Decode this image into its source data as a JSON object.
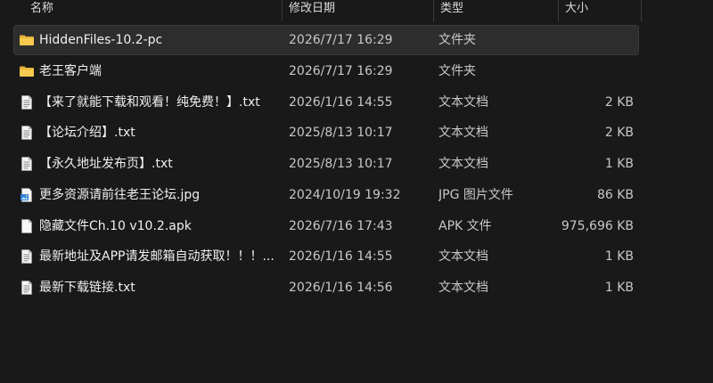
{
  "columns": {
    "name": "名称",
    "date": "修改日期",
    "type": "类型",
    "size": "大小"
  },
  "files": [
    {
      "icon": "folder-icon",
      "name": "HiddenFiles-10.2-pc",
      "date": "2026/7/17 16:29",
      "type": "文件夹",
      "size": "",
      "selected": true
    },
    {
      "icon": "folder-icon",
      "name": "老王客户端",
      "date": "2026/7/17 16:29",
      "type": "文件夹",
      "size": "",
      "selected": false
    },
    {
      "icon": "text-file-icon",
      "name": "【来了就能下载和观看！纯免费！】.txt",
      "date": "2026/1/16 14:55",
      "type": "文本文档",
      "size": "2 KB",
      "selected": false
    },
    {
      "icon": "text-file-icon",
      "name": "【论坛介绍】.txt",
      "date": "2025/8/13 10:17",
      "type": "文本文档",
      "size": "2 KB",
      "selected": false
    },
    {
      "icon": "text-file-icon",
      "name": "【永久地址发布页】.txt",
      "date": "2025/8/13 10:17",
      "type": "文本文档",
      "size": "1 KB",
      "selected": false
    },
    {
      "icon": "image-file-icon",
      "name": "更多资源请前往老王论坛.jpg",
      "date": "2024/10/19 19:32",
      "type": "JPG 图片文件",
      "size": "86 KB",
      "selected": false
    },
    {
      "icon": "blank-file-icon",
      "name": "隐藏文件Ch.10 v10.2.apk",
      "date": "2026/7/16 17:43",
      "type": "APK 文件",
      "size": "975,696 KB",
      "selected": false
    },
    {
      "icon": "text-file-icon",
      "name": "最新地址及APP请发邮箱自动获取！！！...",
      "date": "2026/1/16 14:55",
      "type": "文本文档",
      "size": "1 KB",
      "selected": false
    },
    {
      "icon": "text-file-icon",
      "name": "最新下载链接.txt",
      "date": "2026/1/16 14:56",
      "type": "文本文档",
      "size": "1 KB",
      "selected": false
    }
  ],
  "colors": {
    "background": "#191919",
    "selected_row": "#2d2d2d",
    "folder": "#f3c24c"
  }
}
